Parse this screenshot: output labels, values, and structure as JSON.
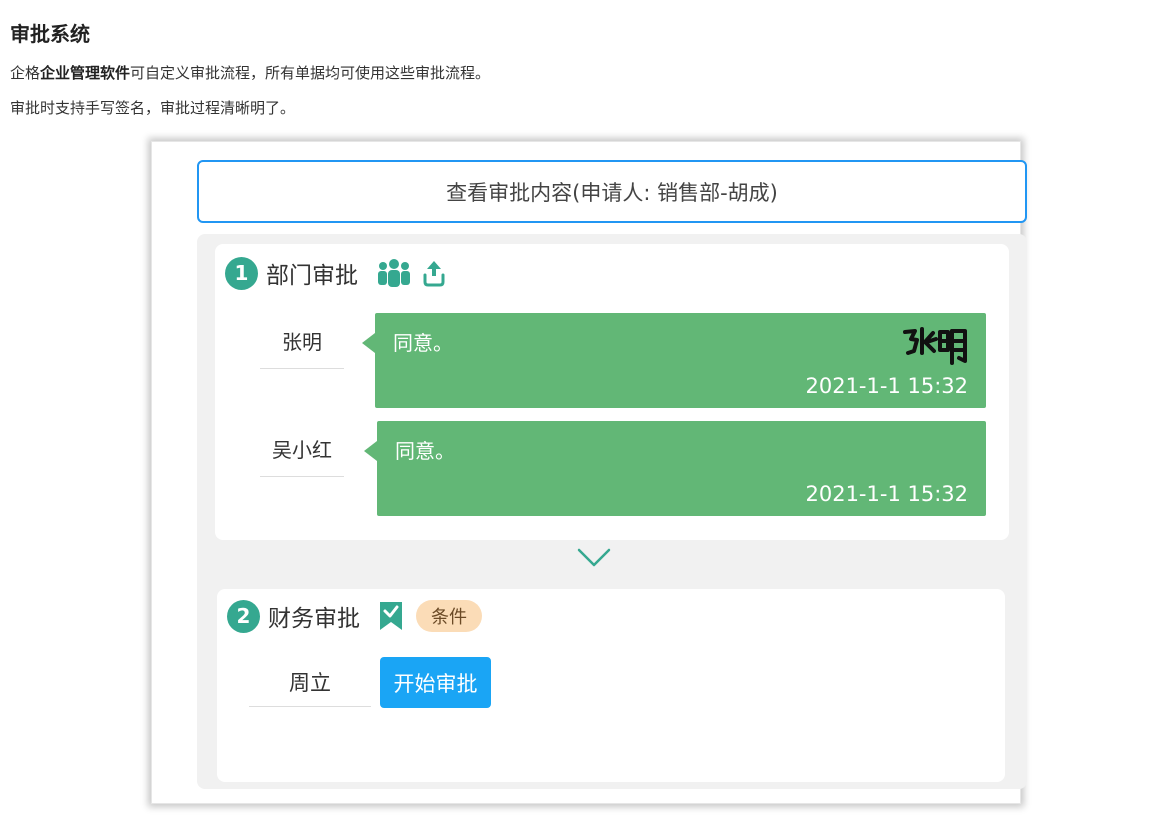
{
  "article": {
    "title": "审批系统",
    "line1_pre": "企格",
    "line1_bold": "企业管理软件",
    "line1_post": "可自定义审批流程，所有单据均可使用这些审批流程。",
    "line2": "审批时支持手写签名，审批过程清晰明了。"
  },
  "app": {
    "view_button": "查看审批内容(申请人: 销售部-胡成)",
    "steps": [
      {
        "number": "1",
        "title": "部门审批",
        "icons": [
          "group-icon",
          "upload-icon"
        ],
        "approvals": [
          {
            "name": "张明",
            "comment": "同意。",
            "time": "2021-1-1 15:32",
            "signature": "张明"
          },
          {
            "name": "吴小红",
            "comment": "同意。",
            "time": "2021-1-1 15:32"
          }
        ]
      },
      {
        "number": "2",
        "title": "财务审批",
        "icons": [
          "bookmark-check-icon"
        ],
        "badge": "条件",
        "approver": "周立",
        "start_button": "开始审批"
      }
    ]
  },
  "colors": {
    "accent_blue": "#2196f3",
    "approve_green": "#62b776",
    "step_teal": "#35a890",
    "badge_bg": "#fbdcb7",
    "start_blue": "#1aa5f5"
  }
}
